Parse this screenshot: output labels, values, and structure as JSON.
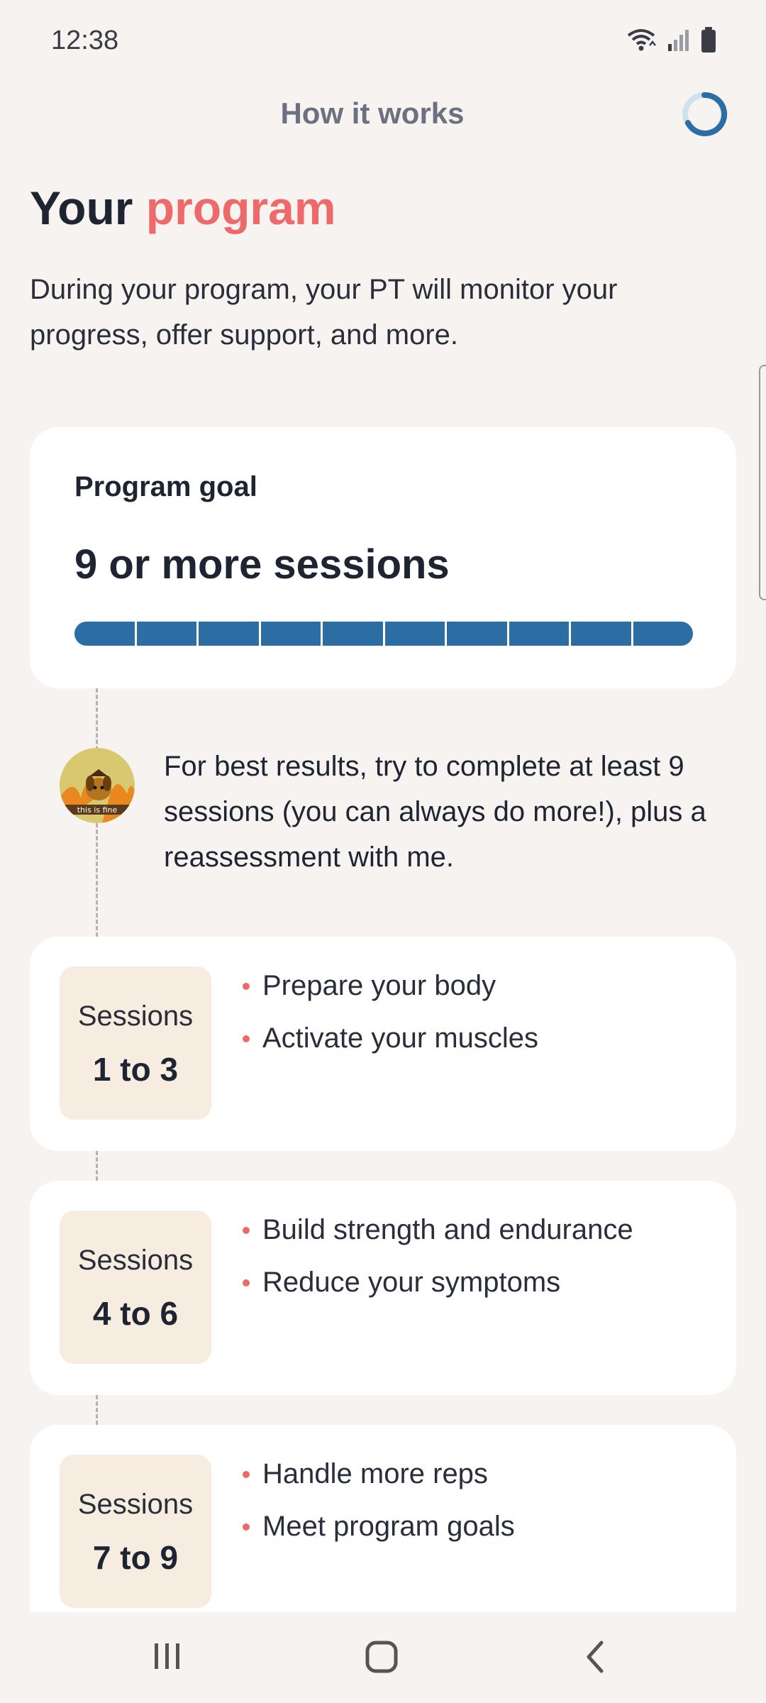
{
  "status_bar": {
    "time": "12:38",
    "icons": [
      "wifi-icon",
      "signal-icon",
      "battery-icon"
    ]
  },
  "header": {
    "title": "How it works",
    "progress_icon": "progress-ring-icon"
  },
  "page": {
    "title_part1": "Your",
    "title_part2": "program",
    "intro": "During your program, your PT will monitor your progress, offer support, and more."
  },
  "goal": {
    "label": "Program goal",
    "value": "9 or more sessions",
    "segments": 10,
    "completed_fraction": 1.0
  },
  "coach": {
    "avatar_icon": "dog-avatar",
    "avatar_caption": "this is fine",
    "message": "For best results, try to complete at least 9 sessions (you can always do more!), plus a reassessment with me."
  },
  "sessions": [
    {
      "label": "Sessions",
      "range": "1 to 3",
      "items": [
        "Prepare your body",
        "Activate your muscles"
      ]
    },
    {
      "label": "Sessions",
      "range": "4 to 6",
      "items": [
        "Build strength and endurance",
        "Reduce your symptoms"
      ]
    },
    {
      "label": "Sessions",
      "range": "7 to 9",
      "items": [
        "Handle more reps",
        "Meet program goals"
      ]
    }
  ],
  "nav": {
    "recent": "recent-apps-icon",
    "home": "home-icon",
    "back": "back-icon"
  },
  "colors": {
    "accent": "#ee6a6a",
    "progress": "#2c6ea4",
    "badge_bg": "#f6ece0",
    "background": "#f6f3f0"
  }
}
